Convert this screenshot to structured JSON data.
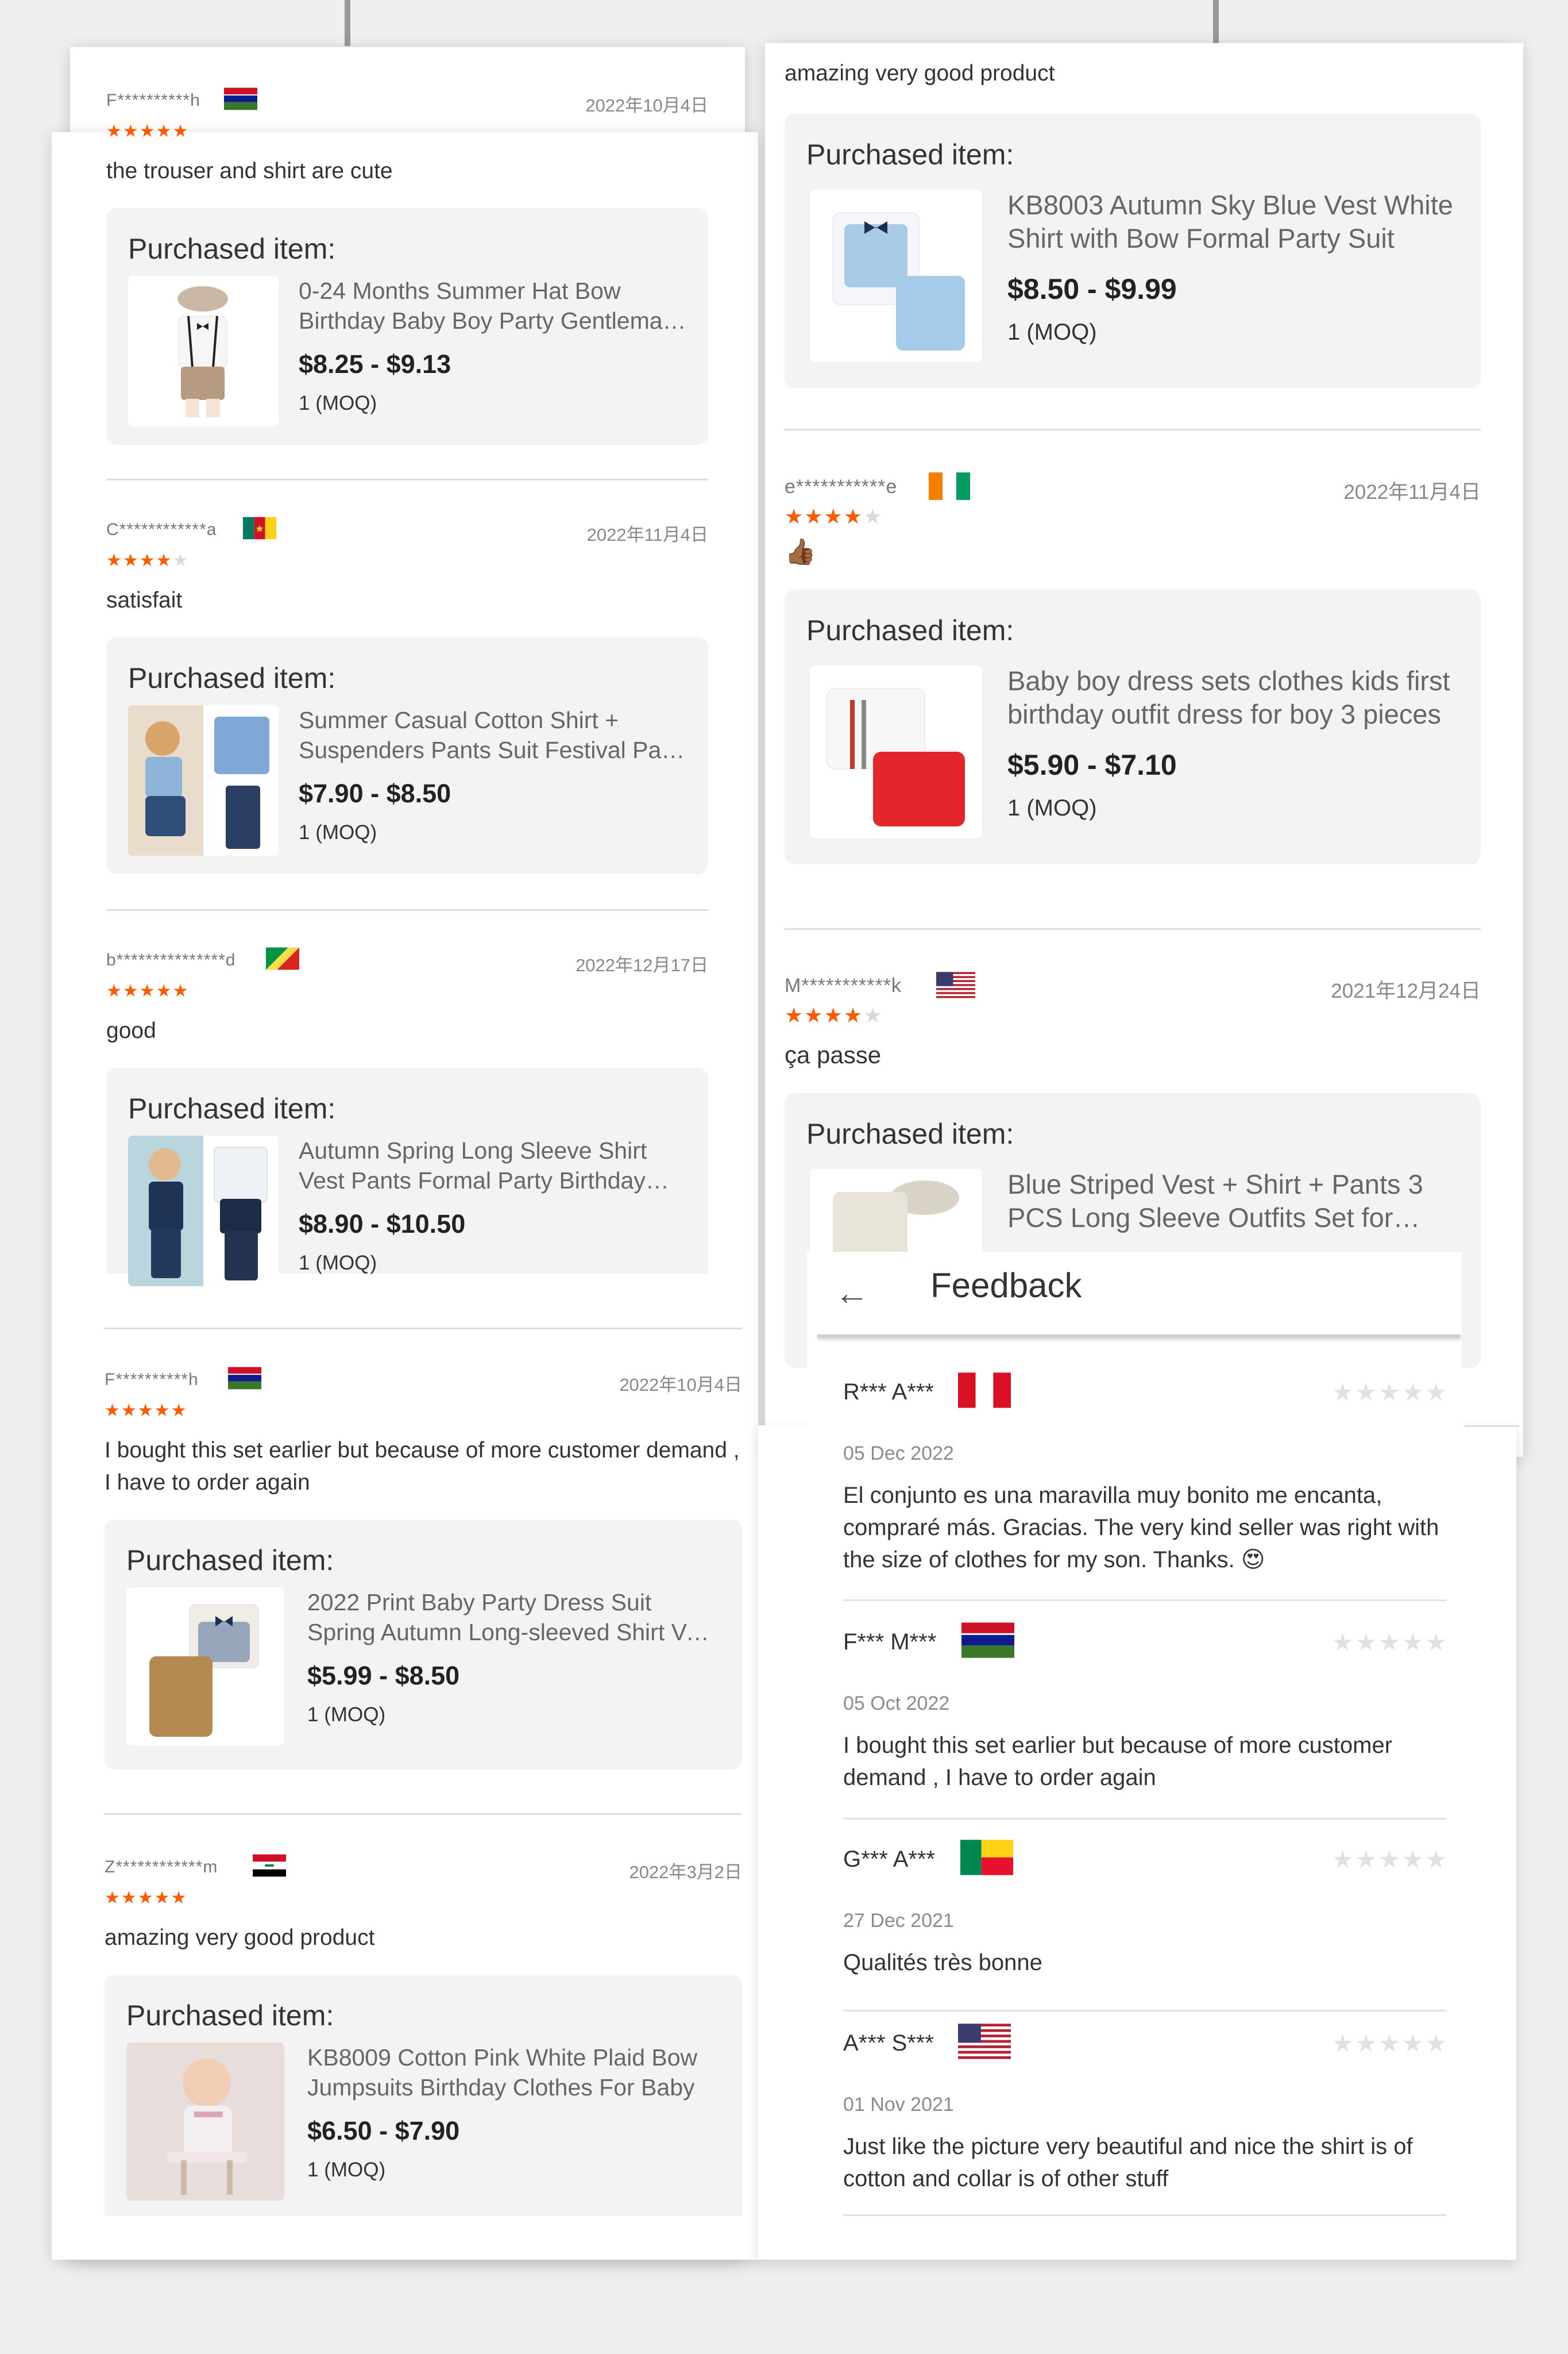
{
  "left_column": {
    "reviews": [
      {
        "user": "F**********h",
        "date": "2022年10月4日",
        "rating": 5,
        "text": "the trouser and shirt are cute",
        "product": {
          "heading": "Purchased item:",
          "name": "0-24 Months Summer Hat Bow Birthday Baby Boy Party Gentleman Clothing Set",
          "price": "$8.25 - $9.13",
          "moq": "1 (MOQ)"
        }
      },
      {
        "user": "C************a",
        "date": "2022年11月4日",
        "rating": 4,
        "text": "satisfait",
        "product": {
          "heading": "Purchased item:",
          "name": "Summer Casual Cotton Shirt + Suspenders Pants Suit Festival Party Outfit",
          "price": "$7.90 - $8.50",
          "moq": "1 (MOQ)"
        }
      },
      {
        "user": "b***************d",
        "date": "2022年12月17日",
        "rating": 5,
        "text": "good",
        "product": {
          "heading": "Purchased item:",
          "name": "Autumn Spring Long Sleeve Shirt Vest Pants  Formal Party Birthday Outfit",
          "price": "$8.90 - $10.50",
          "moq": "1 (MOQ)"
        }
      },
      {
        "user": "F**********h",
        "date": "2022年10月4日",
        "rating": 5,
        "text": "I bought this set earlier but because of more customer demand , I have to order again",
        "product": {
          "heading": "Purchased item:",
          "name": "2022 Print Baby Party Dress Suit Spring Autumn Long-sleeved Shirt Vest Set",
          "price": "$5.99 - $8.50",
          "moq": "1 (MOQ)"
        }
      },
      {
        "user": "Z************m",
        "date": "2022年3月2日",
        "rating": 5,
        "text": "amazing very good product",
        "product": {
          "heading": "Purchased item:",
          "name": "KB8009 Cotton Pink White Plaid Bow Jumpsuits Birthday Clothes For Baby",
          "price": "$6.50 - $7.90",
          "moq": "1 (MOQ)"
        }
      }
    ]
  },
  "right_column": {
    "top_text": "amazing very good product",
    "top_product": {
      "heading": "Purchased item:",
      "name": "KB8003  Autumn Sky Blue Vest White Shirt with Bow Formal Party Suit",
      "price": "$8.50 - $9.99",
      "moq": "1 (MOQ)"
    },
    "reviews": [
      {
        "user": "e***********e",
        "date": "2022年11月4日",
        "rating": 4,
        "emoji": "👍🏾",
        "product": {
          "heading": "Purchased item:",
          "name": "Baby boy dress sets clothes kids first birthday outfit dress for boy 3 pieces",
          "price": "$5.90 - $7.10",
          "moq": "1 (MOQ)"
        }
      },
      {
        "user": "M***********k",
        "date": "2021年12月24日",
        "rating": 4,
        "text": "ça passe",
        "product": {
          "heading": "Purchased item:",
          "name": "Blue Striped Vest + Shirt + Pants 3 PCS Long Sleeve Outfits Set for Baby Boys"
        }
      }
    ]
  },
  "feedback": {
    "back_icon": "arrow-left-icon",
    "title": "Feedback",
    "items": [
      {
        "user": "R*** A***",
        "date": "05 Dec 2022",
        "text": "El conjunto es una maravilla muy bonito me encanta, compraré más. Gracias. The very kind seller was right with the size of clothes for my son. Thanks. 😍"
      },
      {
        "user": "F*** M***",
        "date": "05 Oct 2022",
        "text": "I bought this set earlier but because of more customer demand , I have to order again"
      },
      {
        "user": "G*** A***",
        "date": "27 Dec 2021",
        "text": "Qualités très bonne"
      },
      {
        "user": "A*** S***",
        "date": "01 Nov 2021",
        "text": "Just like the picture very beautiful and nice the shirt is of cotton and collar is of other stuff"
      }
    ]
  },
  "colors": {
    "star_on": "#ff5a00",
    "star_off": "#d9d9d9",
    "panel": "#f3f3f3",
    "background": "#efefef"
  }
}
